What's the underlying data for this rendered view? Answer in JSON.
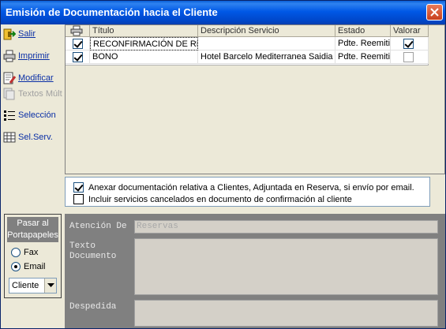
{
  "window": {
    "title": "Emisión de Documentación hacia el Cliente"
  },
  "toolbar": {
    "items": [
      {
        "label": "Salir",
        "icon": "exit-icon",
        "enabled": true
      },
      {
        "label": "Imprimir",
        "icon": "printer-icon",
        "enabled": true
      },
      {
        "label": "Modificar",
        "icon": "edit-icon",
        "enabled": true
      },
      {
        "label": "Textos Múlt",
        "icon": "multi-text-icon",
        "enabled": false
      },
      {
        "label": "Selección",
        "icon": "selection-list-icon",
        "enabled": true
      },
      {
        "label": "Sel.Serv.",
        "icon": "services-grid-icon",
        "enabled": true
      }
    ]
  },
  "grid": {
    "columns": [
      "Título",
      "Descripción Servicio",
      "Estado",
      "Valorar"
    ],
    "rows": [
      {
        "print": true,
        "titulo": "RECONFIRMACIÓN DE RESE",
        "descripcion": "",
        "estado": "Pdte. Reemitir",
        "valorar": true
      },
      {
        "print": true,
        "titulo": "BONO",
        "descripcion": "Hotel Barcelo Mediterranea Saidia",
        "estado": "Pdte. Reemitir",
        "valorar": false
      }
    ]
  },
  "options": {
    "anexar": {
      "label": "Anexar documentación relativa a Clientes, Adjuntada en Reserva, si envío por email.",
      "checked": true
    },
    "incluir": {
      "label": "Incluir servicios cancelados en documento de confirmación al cliente",
      "checked": false
    }
  },
  "clipboard": {
    "title_line1": "Pasar al",
    "title_line2": "Portapapeles",
    "radios": [
      {
        "label": "Fax",
        "selected": false
      },
      {
        "label": "Email",
        "selected": true
      }
    ],
    "select_value": "Cliente"
  },
  "form": {
    "atencion_label": "Atención De",
    "atencion_value": "Reservas",
    "texto_label_1": "Texto",
    "texto_label_2": "Documento",
    "despedida_label": "Despedida"
  },
  "colors": {
    "title_bar": "#0058e6",
    "link_text": "#0a2fa6",
    "bottom_panel": "#808080"
  }
}
